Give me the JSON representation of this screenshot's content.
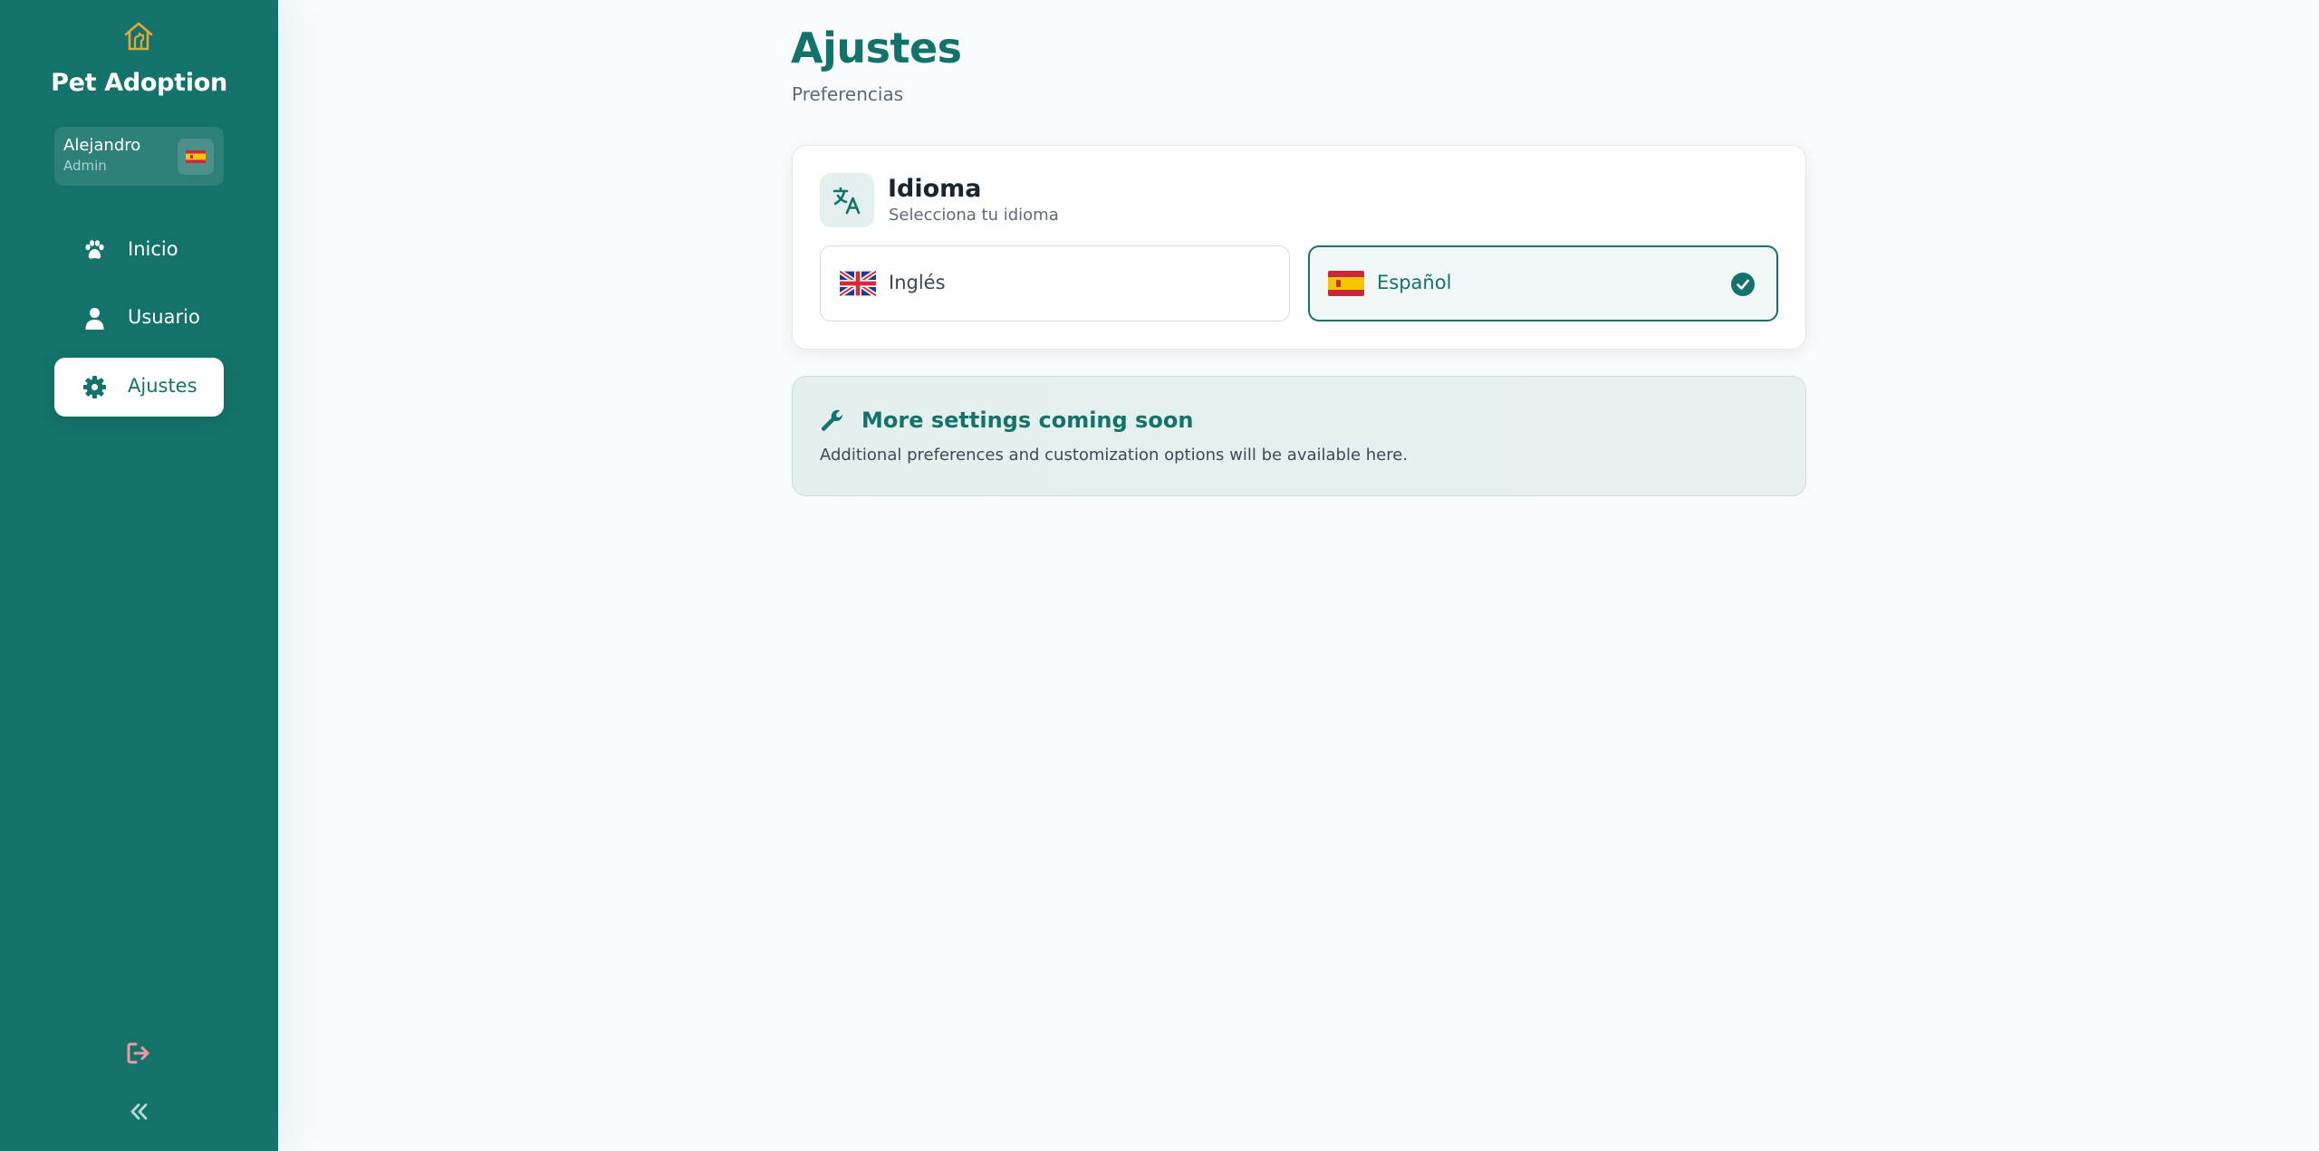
{
  "colors": {
    "brand": "#13736b",
    "accent_gold": "#e0a83a",
    "logout_pink": "#f19aa0"
  },
  "sidebar": {
    "logo_icon": "house-dog-icon",
    "app_name": "Pet Adoption",
    "user": {
      "name": "Alejandro",
      "role": "Admin",
      "flag_icon": "spain-flag-icon"
    },
    "nav": [
      {
        "label": "Inicio",
        "icon": "paw-icon",
        "active": false
      },
      {
        "label": "Usuario",
        "icon": "user-icon",
        "active": false
      },
      {
        "label": "Ajustes",
        "icon": "gear-icon",
        "active": true
      }
    ],
    "logout_icon": "logout-icon",
    "collapse_icon": "double-chevron-left-icon"
  },
  "page": {
    "title": "Ajustes",
    "subtitle": "Preferencias"
  },
  "language_card": {
    "icon": "translate-icon",
    "title": "Idioma",
    "subtitle": "Selecciona tu idioma",
    "options": [
      {
        "label": "Inglés",
        "flag": "uk-flag-icon",
        "selected": false
      },
      {
        "label": "Español",
        "flag": "spain-flag-icon",
        "selected": true
      }
    ]
  },
  "coming_soon": {
    "icon": "wrench-icon",
    "title": "More settings coming soon",
    "text": "Additional preferences and customization options will be available here."
  }
}
